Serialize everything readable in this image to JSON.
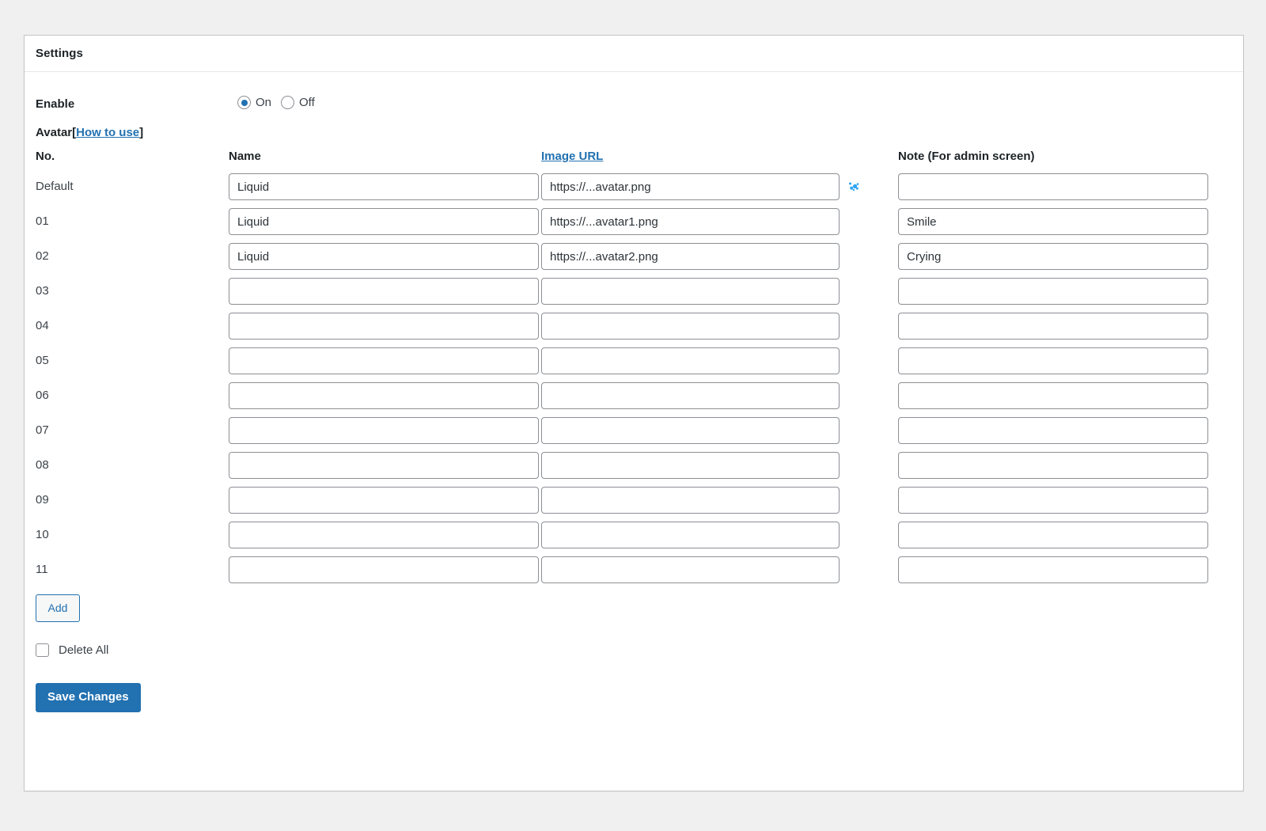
{
  "card": {
    "title": "Settings"
  },
  "enable": {
    "label": "Enable",
    "options": [
      {
        "label": "On",
        "checked": true
      },
      {
        "label": "Off",
        "checked": false
      }
    ]
  },
  "avatar_section": {
    "heading": "Avatar",
    "bracket_open": "[",
    "how_to_use_link": "How to use",
    "bracket_close": "]"
  },
  "table": {
    "headers": {
      "no": "No.",
      "name": "Name",
      "image_url": "Image URL",
      "note": "Note (For admin screen)"
    },
    "rows": [
      {
        "no": "Default",
        "name": "Liquid",
        "url": "https://...avatar.png",
        "note": "",
        "has_status_icon": true
      },
      {
        "no": "01",
        "name": "Liquid",
        "url": "https://...avatar1.png",
        "note": "Smile",
        "has_status_icon": false
      },
      {
        "no": "02",
        "name": "Liquid",
        "url": "https://...avatar2.png",
        "note": "Crying",
        "has_status_icon": false
      },
      {
        "no": "03",
        "name": "",
        "url": "",
        "note": "",
        "has_status_icon": false
      },
      {
        "no": "04",
        "name": "",
        "url": "",
        "note": "",
        "has_status_icon": false
      },
      {
        "no": "05",
        "name": "",
        "url": "",
        "note": "",
        "has_status_icon": false
      },
      {
        "no": "06",
        "name": "",
        "url": "",
        "note": "",
        "has_status_icon": false
      },
      {
        "no": "07",
        "name": "",
        "url": "",
        "note": "",
        "has_status_icon": false
      },
      {
        "no": "08",
        "name": "",
        "url": "",
        "note": "",
        "has_status_icon": false
      },
      {
        "no": "09",
        "name": "",
        "url": "",
        "note": "",
        "has_status_icon": false
      },
      {
        "no": "10",
        "name": "",
        "url": "",
        "note": "",
        "has_status_icon": false
      },
      {
        "no": "11",
        "name": "",
        "url": "",
        "note": "",
        "has_status_icon": false
      }
    ]
  },
  "actions": {
    "add_label": "Add",
    "delete_all_label": "Delete All",
    "delete_all_checked": false,
    "save_label": "Save Changes"
  },
  "icons": {
    "image_status": "broken-image-icon"
  },
  "colors": {
    "accent": "#2271b1",
    "link": "#2271b1",
    "page_bg": "#f0f0f1",
    "card_bg": "#ffffff",
    "card_border": "#c3c4c7",
    "input_border": "#8c8f94",
    "text": "#3c434a",
    "heading_text": "#1d2327",
    "status_icon": "#2ea3f2"
  }
}
